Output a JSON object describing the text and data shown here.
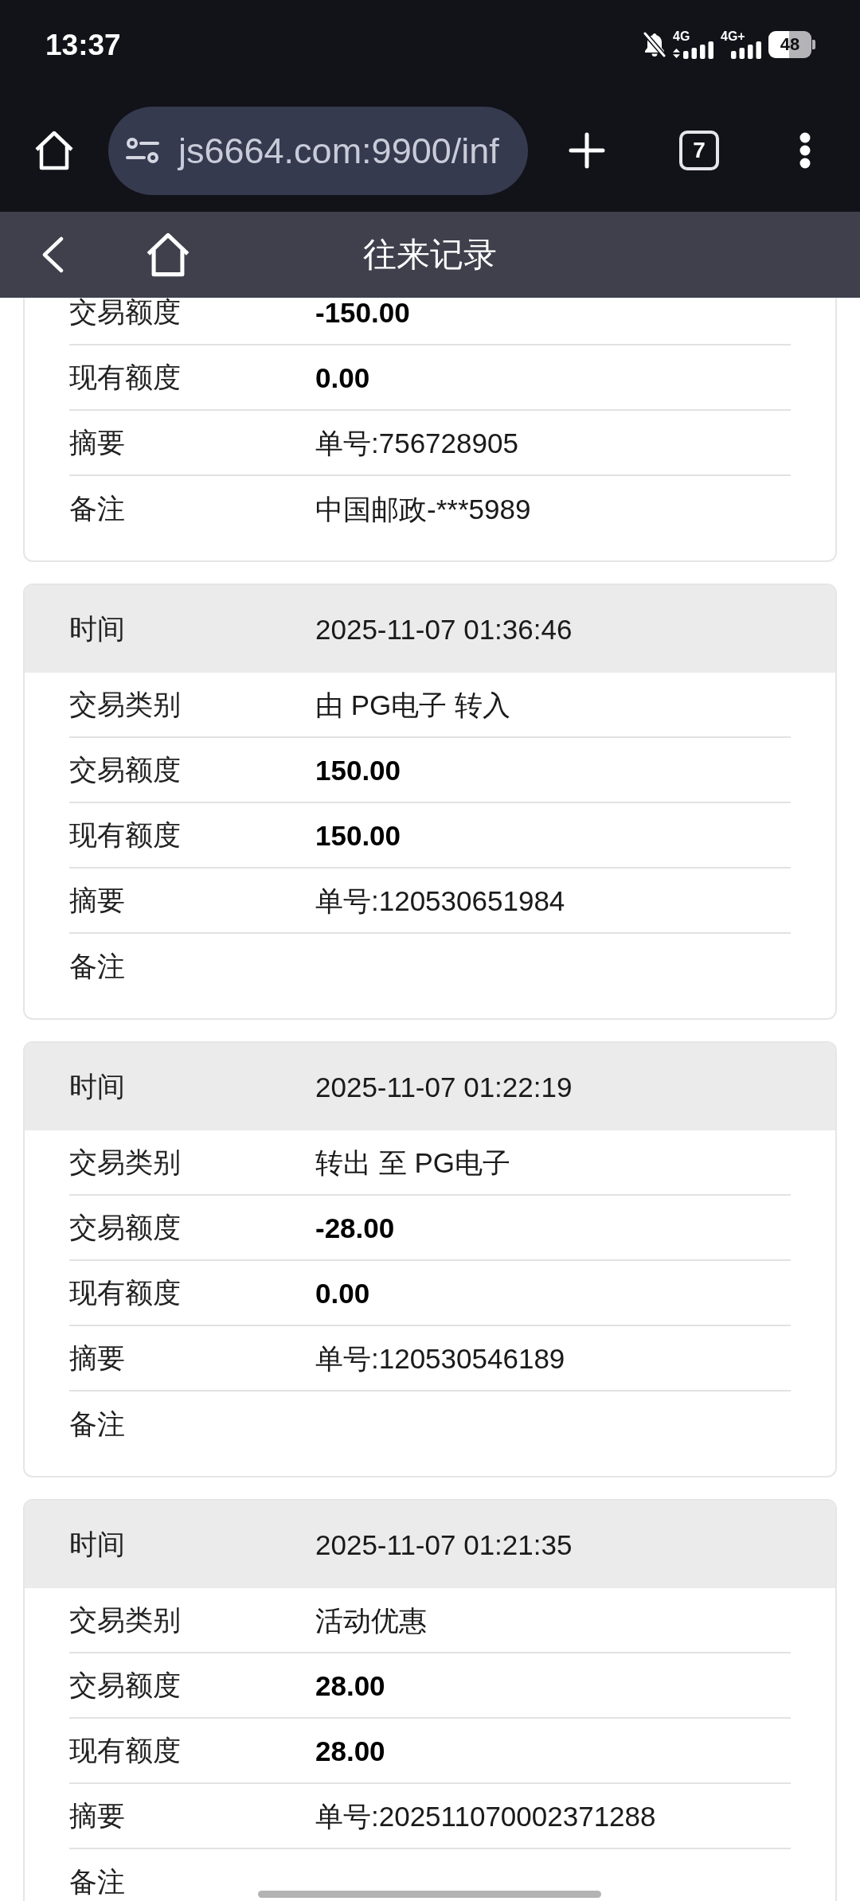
{
  "status_bar": {
    "time": "13:37",
    "notifications_muted": true,
    "networks": [
      {
        "type": "4G",
        "arrows": true
      },
      {
        "type": "4G+",
        "arrows": false
      }
    ],
    "battery": "48"
  },
  "browser": {
    "url": "js6664.com:9900/inf",
    "tab_count": "7"
  },
  "header": {
    "title": "往来记录"
  },
  "records": [
    {
      "rows": [
        {
          "label": "交易额度",
          "value": "-150.00",
          "kind": "amount"
        },
        {
          "label": "现有额度",
          "value": "0.00",
          "kind": "amount"
        },
        {
          "label": "摘要",
          "value": "单号:756728905",
          "kind": "text"
        },
        {
          "label": "备注",
          "value": "中国邮政-***5989",
          "kind": "text"
        }
      ]
    },
    {
      "time": {
        "label": "时间",
        "value": "2025-11-07 01:36:46"
      },
      "rows": [
        {
          "label": "交易类别",
          "value": "由 PG电子 转入",
          "kind": "text"
        },
        {
          "label": "交易额度",
          "value": "150.00",
          "kind": "amount"
        },
        {
          "label": "现有额度",
          "value": "150.00",
          "kind": "amount"
        },
        {
          "label": "摘要",
          "value": "单号:120530651984",
          "kind": "text"
        },
        {
          "label": "备注",
          "kind": "text"
        }
      ]
    },
    {
      "time": {
        "label": "时间",
        "value": "2025-11-07 01:22:19"
      },
      "rows": [
        {
          "label": "交易类别",
          "value": "转出 至 PG电子",
          "kind": "text"
        },
        {
          "label": "交易额度",
          "value": "-28.00",
          "kind": "amount"
        },
        {
          "label": "现有额度",
          "value": "0.00",
          "kind": "amount"
        },
        {
          "label": "摘要",
          "value": "单号:120530546189",
          "kind": "text"
        },
        {
          "label": "备注",
          "kind": "text"
        }
      ]
    },
    {
      "time": {
        "label": "时间",
        "value": "2025-11-07 01:21:35"
      },
      "rows": [
        {
          "label": "交易类别",
          "value": "活动优惠",
          "kind": "text"
        },
        {
          "label": "交易额度",
          "value": "28.00",
          "kind": "amount"
        },
        {
          "label": "现有额度",
          "value": "28.00",
          "kind": "amount"
        },
        {
          "label": "摘要",
          "value": "单号:202511070002371288",
          "kind": "text"
        },
        {
          "label": "备注",
          "kind": "text"
        }
      ]
    }
  ]
}
